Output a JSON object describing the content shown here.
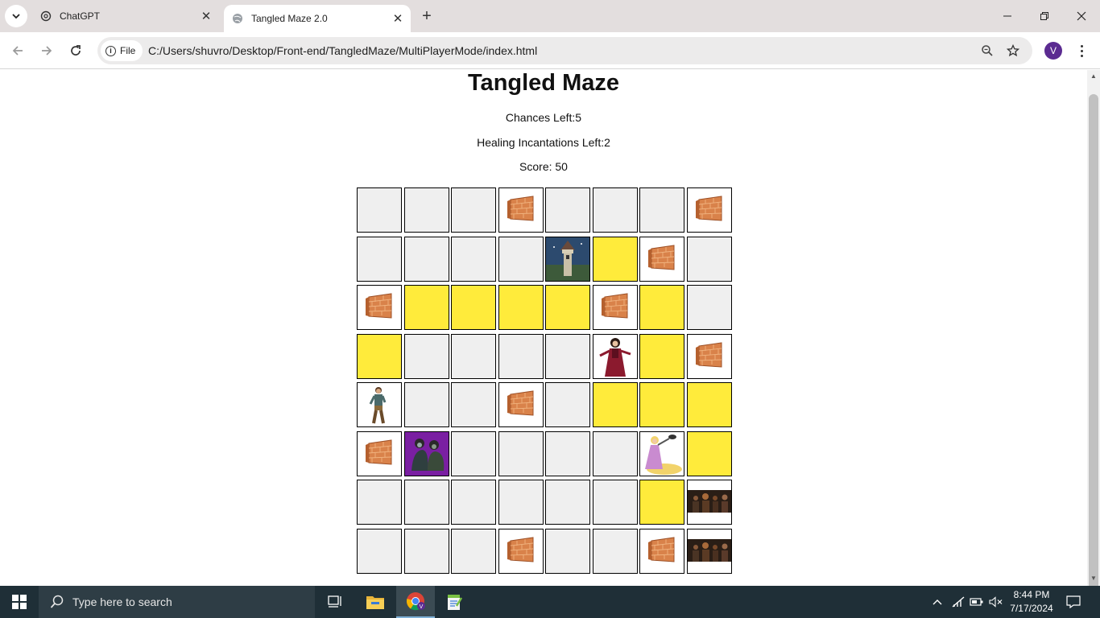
{
  "browser": {
    "tabs": [
      {
        "title": "ChatGPT",
        "active": false
      },
      {
        "title": "Tangled Maze 2.0",
        "active": true
      }
    ],
    "file_chip": "File",
    "url": "C:/Users/shuvro/Desktop/Front-end/TangledMaze/MultiPlayerMode/index.html",
    "profile_initial": "V"
  },
  "page": {
    "title": "Tangled Maze",
    "chances": "Chances Left:5",
    "healing": "Healing Incantations Left:2",
    "score": "Score: 50"
  },
  "maze": {
    "legend": {
      "E": "empty",
      "Y": "path",
      "W": "wall",
      "T": "tower",
      "G": "gothel",
      "F": "flynn",
      "R": "rapunzel",
      "P": "ruffians",
      "H": "thugs"
    },
    "rows": [
      [
        "E",
        "E",
        "E",
        "W",
        "E",
        "E",
        "E",
        "W"
      ],
      [
        "E",
        "E",
        "E",
        "E",
        "T",
        "Y",
        "W",
        "E"
      ],
      [
        "W",
        "Y",
        "Y",
        "Y",
        "Y",
        "W",
        "Y",
        "E"
      ],
      [
        "Y",
        "E",
        "E",
        "E",
        "E",
        "G",
        "Y",
        "W"
      ],
      [
        "F",
        "E",
        "E",
        "W",
        "E",
        "Y",
        "Y",
        "Y"
      ],
      [
        "W",
        "P",
        "E",
        "E",
        "E",
        "E",
        "R",
        "Y"
      ],
      [
        "E",
        "E",
        "E",
        "E",
        "E",
        "E",
        "Y",
        "H"
      ],
      [
        "E",
        "E",
        "E",
        "W",
        "E",
        "E",
        "W",
        "H"
      ]
    ]
  },
  "taskbar": {
    "search_placeholder": "Type here to search",
    "time": "8:44 PM",
    "date": "7/17/2024"
  },
  "colors": {
    "path": "#ffeb3b",
    "empty": "#efefef",
    "taskbar": "#1f2f37"
  }
}
